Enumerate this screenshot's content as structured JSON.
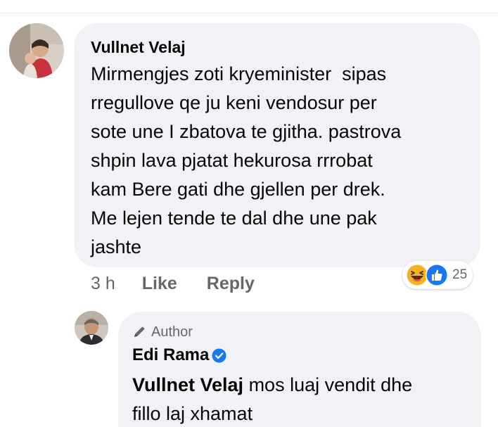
{
  "comment": {
    "author": "Vullnet Velaj",
    "text": "Mirmengjes zoti kryeminister  sipas rregullove qe ju keni vendosur per sote une I zbatova te gjitha. pastrova shpin lava pjatat hekurosa rrrobat kam Bere gati dhe gjellen per drek. Me lejen tende te dal dhe une pak jashte",
    "lines": [
      "Mirmengjes zoti kryeminister  sipas",
      "rregullove qe ju keni vendosur per",
      "sote une I zbatova te gjitha. pastrova",
      "shpin lava pjatat hekurosa rrrobat",
      "kam Bere gati dhe gjellen per drek.",
      "Me lejen tende te dal dhe une pak",
      "jashte"
    ],
    "time": "3 h",
    "like_label": "Like",
    "reply_label": "Reply",
    "reactions": {
      "icons": [
        "haha-icon",
        "like-icon"
      ],
      "count": "25"
    }
  },
  "reply": {
    "badge": "Author",
    "author": "Edi Rama",
    "verified": true,
    "mention": "Vullnet Velaj",
    "text_line1": " mos luaj vendit dhe",
    "text_line2": "fillo laj xhamat"
  },
  "colors": {
    "bubble": "#f0f2f5",
    "secondary_text": "#65676b",
    "primary_text": "#050505",
    "like_blue": "#1877f2",
    "haha_yellow": "#f7b125"
  }
}
